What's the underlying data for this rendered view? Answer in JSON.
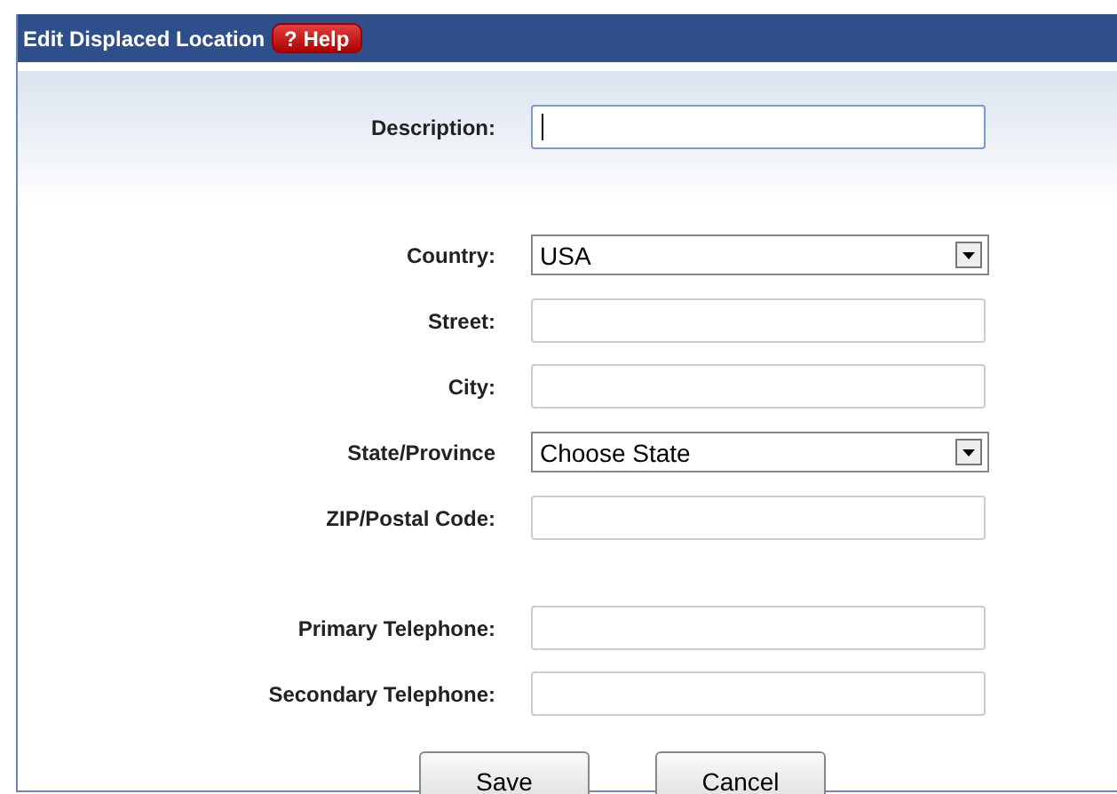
{
  "window": {
    "title": "Edit Displaced Location",
    "help_button": "? Help"
  },
  "groups": [
    {
      "fields": [
        {
          "label": "Description:",
          "kind": "text",
          "focused": true
        }
      ]
    },
    {
      "fields": [
        {
          "label": "Country:",
          "kind": "select",
          "value": "USA"
        },
        {
          "label": "Street:",
          "kind": "text",
          "focused": false
        },
        {
          "label": "City:",
          "kind": "text",
          "focused": false
        },
        {
          "label": "State/Province",
          "kind": "select",
          "value": "Choose State"
        },
        {
          "label": "ZIP/Postal Code:",
          "kind": "text",
          "focused": false
        }
      ]
    },
    {
      "fields": [
        {
          "label": "Primary Telephone:",
          "kind": "text",
          "focused": false
        },
        {
          "label": "Secondary Telephone:",
          "kind": "text",
          "focused": false
        }
      ]
    }
  ],
  "buttons": [
    "Save",
    "Cancel"
  ]
}
